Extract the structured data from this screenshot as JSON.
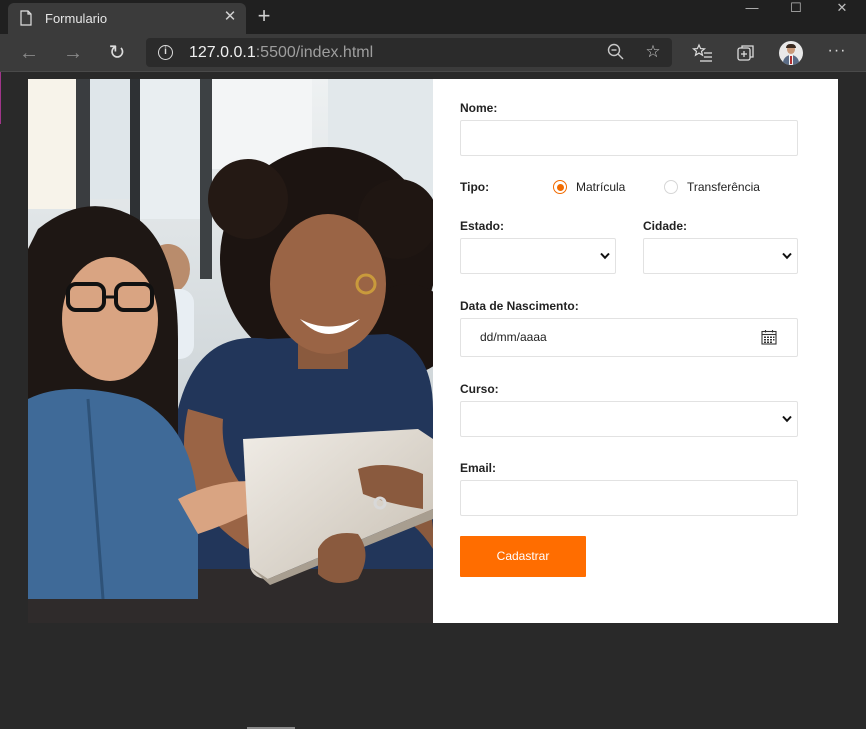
{
  "browser": {
    "tab_title": "Formulario",
    "tab_close": "✕",
    "new_tab": "+",
    "url_host": "127.0.0.1",
    "url_rest": ":5500/index.html",
    "info_glyph": "i",
    "icons": [
      "page-icon",
      "close-icon",
      "plus-icon",
      "back-icon",
      "forward-icon",
      "reload-icon",
      "info-icon",
      "zoom-out-icon",
      "favorite-star-icon",
      "favorites-list-icon",
      "collections-icon",
      "avatar",
      "more-icon"
    ]
  },
  "form": {
    "name_label": "Nome:",
    "name_value": "",
    "tipo_label": "Tipo:",
    "tipo_options": [
      "Matrícula",
      "Transferência"
    ],
    "tipo_selected": "Matrícula",
    "estado_label": "Estado:",
    "estado_value": "",
    "cidade_label": "Cidade:",
    "cidade_value": "",
    "nascimento_label": "Data de Nascimento:",
    "nascimento_placeholder": "dd/mm/aaaa",
    "curso_label": "Curso:",
    "curso_value": "",
    "email_label": "Email:",
    "email_value": "",
    "submit_label": "Cadastrar"
  },
  "colors": {
    "accent": "#ff6d00",
    "radio_accent": "#f26b00",
    "page_bg": "#292929",
    "card_bg": "#ffffff"
  }
}
